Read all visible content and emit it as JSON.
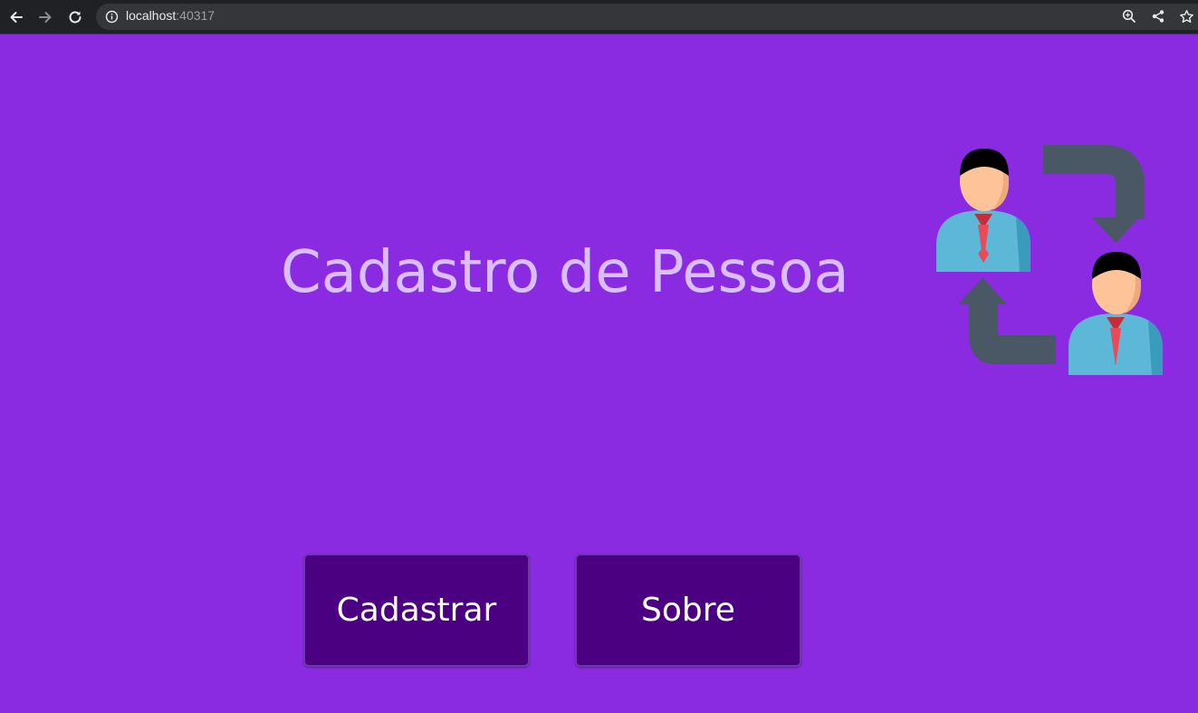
{
  "browser": {
    "url_host": "localhost",
    "url_port": ":40317"
  },
  "page": {
    "title": "Cadastro de Pessoa",
    "buttons": {
      "register_label": "Cadastrar",
      "about_label": "Sobre"
    }
  },
  "colors": {
    "background": "#8a2be2",
    "button_bg": "#4b0082",
    "title_text": "#d9bfff",
    "button_text": "#ffffff"
  },
  "icons": {
    "back": "arrow-left-icon",
    "forward": "arrow-right-icon",
    "reload": "reload-icon",
    "site_info": "info-icon",
    "zoom": "zoom-icon",
    "share": "share-icon",
    "bookmark": "star-icon",
    "illustration": "people-exchange-icon"
  }
}
